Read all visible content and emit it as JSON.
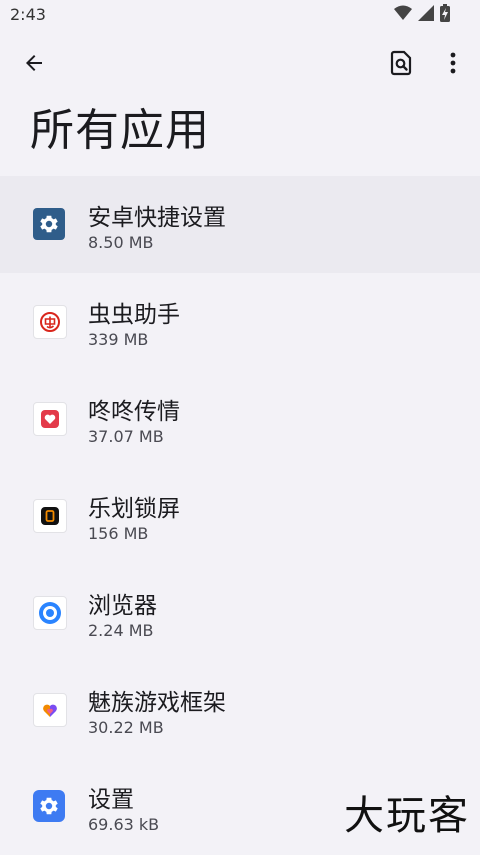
{
  "status_bar": {
    "time": "2:43"
  },
  "header": {
    "title": "所有应用"
  },
  "apps": [
    {
      "name": "安卓快捷设置",
      "size": "8.50 MB",
      "icon": "gear-icon",
      "color": "#2f5d8a"
    },
    {
      "name": "虫虫助手",
      "size": "339 MB",
      "icon": "bug-helper-icon",
      "color": "#d9261c"
    },
    {
      "name": "咚咚传情",
      "size": "37.07 MB",
      "icon": "heart-icon",
      "color": "#e33a4a"
    },
    {
      "name": "乐划锁屏",
      "size": "156 MB",
      "icon": "lock-screen-icon",
      "color": "#f28a00"
    },
    {
      "name": "浏览器",
      "size": "2.24 MB",
      "icon": "browser-icon",
      "color": "#2a84ff"
    },
    {
      "name": "魅族游戏框架",
      "size": "30.22 MB",
      "icon": "game-framework-icon",
      "color": "#f25f8a"
    },
    {
      "name": "设置",
      "size": "69.63 kB",
      "icon": "settings-gear-icon",
      "color": "#3e7bf2"
    }
  ],
  "watermark": "大玩客"
}
